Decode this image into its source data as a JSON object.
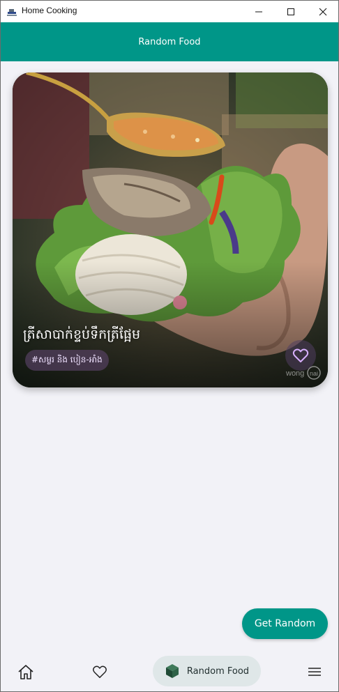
{
  "window": {
    "title": "Home Cooking",
    "icons": [
      "app-icon",
      "minimize-icon",
      "maximize-icon",
      "close-icon"
    ]
  },
  "header": {
    "title": "Random Food",
    "color": "#009688"
  },
  "card": {
    "title": "ត្រីសាបាក់ខ្ទប់ទឹកត្រីផ្អែម",
    "tag": "#សម្លរ និង បៀន-អាំង",
    "favorite_icon": "heart-outline-icon",
    "watermark": "wongnai"
  },
  "actions": {
    "get_random": "Get Random"
  },
  "nav": {
    "items": [
      {
        "icon": "home-icon"
      },
      {
        "icon": "heart-icon"
      },
      {
        "icon": "cube-icon",
        "label": "Random Food",
        "selected": true
      },
      {
        "icon": "menu-icon"
      }
    ],
    "active_bg": "#dfe7e8"
  }
}
